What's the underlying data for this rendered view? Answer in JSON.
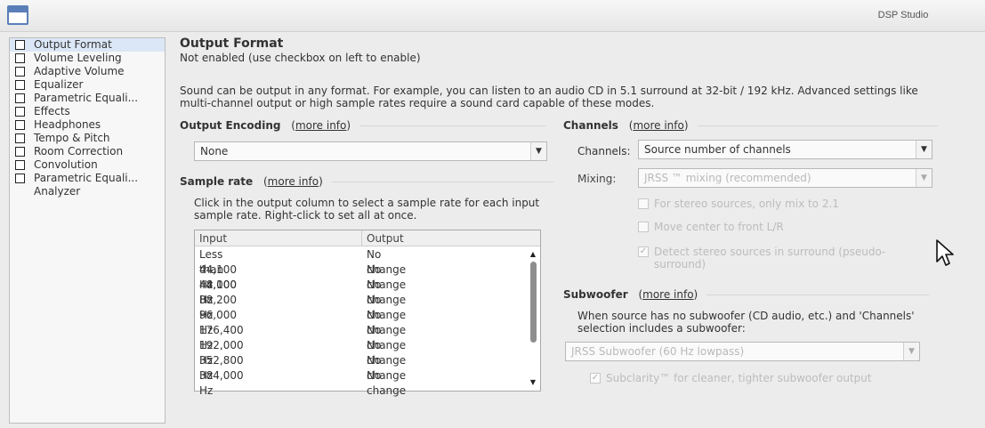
{
  "window": {
    "title": "DSP Studio"
  },
  "sidebar": {
    "items": [
      {
        "label": "Output Format",
        "checkbox": true
      },
      {
        "label": "Volume Leveling",
        "checkbox": true
      },
      {
        "label": "Adaptive Volume",
        "checkbox": true
      },
      {
        "label": "Equalizer",
        "checkbox": true
      },
      {
        "label": "Parametric Equali...",
        "checkbox": true
      },
      {
        "label": "Effects",
        "checkbox": true
      },
      {
        "label": "Headphones",
        "checkbox": true
      },
      {
        "label": "Tempo & Pitch",
        "checkbox": true
      },
      {
        "label": "Room Correction",
        "checkbox": true
      },
      {
        "label": "Convolution",
        "checkbox": true
      },
      {
        "label": "Parametric Equali...",
        "checkbox": true
      },
      {
        "label": "Analyzer",
        "checkbox": false
      }
    ]
  },
  "main": {
    "title": "Output Format",
    "subtitle": "Not enabled (use checkbox on left to enable)",
    "description": "Sound can be output in any format.  For example, you can listen to an audio CD in 5.1 surround at 32-bit / 192 kHz.  Advanced settings like multi-channel output or high sample rates require a sound card capable of these modes.",
    "more_info": "more info",
    "encoding": {
      "heading": "Output Encoding",
      "value": "None"
    },
    "sample_rate": {
      "heading": "Sample rate",
      "instructions": "Click in the output column to select a sample rate for each input sample rate.  Right-click to set all at once.",
      "columns": [
        "Input",
        "Output"
      ],
      "rows": [
        {
          "input": "Less than 44,100 Hz",
          "output": "No change"
        },
        {
          "input": "44,100 Hz",
          "output": "No change"
        },
        {
          "input": "48,000 Hz",
          "output": "No change"
        },
        {
          "input": "88,200 Hz",
          "output": "No change"
        },
        {
          "input": "96,000 Hz",
          "output": "No change"
        },
        {
          "input": "176,400 Hz",
          "output": "No change"
        },
        {
          "input": "192,000 Hz",
          "output": "No change"
        },
        {
          "input": "352,800 Hz",
          "output": "No change"
        },
        {
          "input": "384,000 Hz",
          "output": "No change"
        }
      ]
    },
    "channels": {
      "heading": "Channels",
      "channels_label": "Channels:",
      "channels_value": "Source number of channels",
      "mixing_label": "Mixing:",
      "mixing_value": "JRSS ™ mixing (recommended)",
      "options": [
        {
          "label": "For stereo sources, only mix to 2.1",
          "checked": false
        },
        {
          "label": "Move center to front L/R",
          "checked": false
        },
        {
          "label": "Detect stereo sources in surround (pseudo-surround)",
          "checked": true
        }
      ]
    },
    "subwoofer": {
      "heading": "Subwoofer",
      "instructions": "When source has no subwoofer (CD audio, etc.) and 'Channels' selection includes a subwoofer:",
      "value": "JRSS Subwoofer (60 Hz lowpass)",
      "option": {
        "label": "Subclarity™ for cleaner, tighter subwoofer output",
        "checked": true
      }
    }
  }
}
